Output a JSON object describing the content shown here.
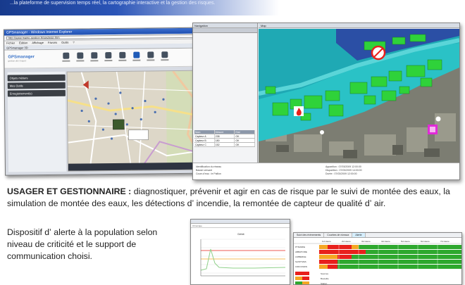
{
  "header": {
    "text": "...la plateforme de supervision temps réel, la cartographie interactive et la gestion des risques."
  },
  "browser": {
    "window_title": "GPSmanager - Windows Internet Explorer",
    "url": "http://www.mairie-gestion.fr/gps/map.htm",
    "menu": [
      "Fichier",
      "Édition",
      "Affichage",
      "Favoris",
      "Outils",
      "?"
    ],
    "tab_label": "GPSmanager 3D",
    "app_name": "GPSmanager",
    "app_subtitle": "gestion des risques",
    "toolbar": [
      "Données",
      "Outils",
      "Couches",
      "Alertes",
      "Capteurs",
      "Carte",
      "Aide",
      "Quitter"
    ],
    "sidebar": [
      "Objets métiers",
      "Mes Outils",
      "Enregistrement(s)"
    ]
  },
  "gis": {
    "nav_title": "Navigation",
    "map_title": "Map",
    "table": {
      "headers": [
        "Nom",
        "Mesure",
        "Etat"
      ],
      "rows": [
        [
          "Capteur A",
          "238",
          "OK"
        ],
        [
          "Capteur B",
          "180",
          "OK"
        ],
        [
          "Capteur C",
          "152",
          "OK"
        ]
      ]
    },
    "info_left": [
      "Identification du réseau",
      "Bassin versant",
      "Cours d'eau : le Paillon"
    ],
    "info_right": [
      "Apparition : 07/03/2009 12:00:00",
      "Disparition : 07/03/2009 14:00:00",
      "Durée : 07/03/2009 12:00:00"
    ]
  },
  "main_text": {
    "bold": "USAGER ET GESTIONNAIRE :",
    "rest": "diagnostiquer, prévenir et agir en cas de risque par le suivi de montée des eaux, la simulation de montée des eaux, les détections dʼ incendie, la remontée de capteur de qualité dʼ air."
  },
  "sub_text": "Dispositif dʼ alerte à la population selon niveau de criticité et le support de communication choisi.",
  "chart_window": {
    "tab": "Chronique",
    "title": "Débit"
  },
  "grid_window": {
    "tabs": [
      "Suivi des évènements",
      "Courbes de niveaux",
      "Alerte"
    ],
    "hours": [
      "1H Heure",
      "2H Heure",
      "3H Heure",
      "4H Heure",
      "5H Heure",
      "6H Heure",
      "7H Heure"
    ],
    "rows": [
      "PTMAIRIE",
      "ABBATOIRE",
      "LIMBERGE",
      "SAINTIVES",
      "CIRCONDIN"
    ],
    "extra_rows": [
      "Sources",
      "Bouteille",
      "Station"
    ],
    "colors": {
      "red": "#e8201c",
      "orange": "#f5a623",
      "green": "#2ea82e",
      "gis_water": "#24c3c8",
      "gis_green": "#2fd23a"
    }
  }
}
